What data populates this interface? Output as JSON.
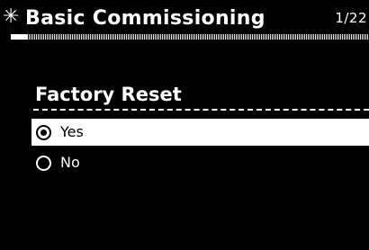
{
  "header": {
    "icon": "asterisk-icon",
    "icon_glyph": "✳",
    "title": "Basic Commissioning",
    "page_indicator": "1/22",
    "progress_fraction": 0.045
  },
  "section": {
    "title": "Factory Reset"
  },
  "options": [
    {
      "label": "Yes",
      "selected": true
    },
    {
      "label": "No",
      "selected": false
    }
  ]
}
